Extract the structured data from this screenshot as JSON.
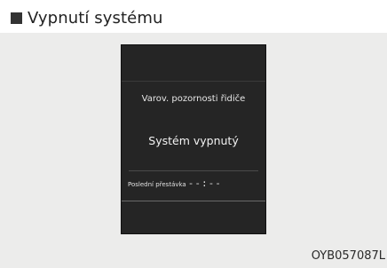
{
  "header": {
    "title": "Vypnutí systému",
    "icon": "black-square-icon"
  },
  "display": {
    "header_text": "Varov. pozornosti řidiče",
    "status_text": "Systém vypnutý",
    "last_break_label": "Poslední přestávka",
    "last_break_value": "--:--"
  },
  "figure_code": "OYB057087L",
  "colors": {
    "panel_background": "#ececeb",
    "screen_background": "#252525",
    "screen_text": "#e6e6e6"
  }
}
